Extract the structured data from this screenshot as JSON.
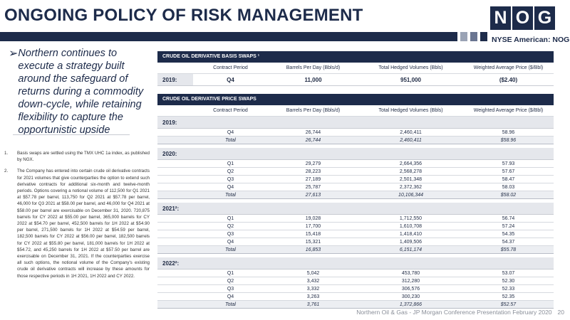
{
  "header": {
    "title": "ONGOING POLICY OF RISK MANAGEMENT",
    "logo_letters": [
      "N",
      "O",
      "G"
    ],
    "ticker": "NYSE American: NOG",
    "accent_squares": [
      "#9aa3b5",
      "#6a7591",
      "#1d2b4a"
    ]
  },
  "left": {
    "bullet_icon": "arrow-bullet",
    "bullet": "Northern continues to execute a strategy built around the safeguard of returns during a commodity down-cycle, while retaining flexibility to capture the opportunistic upside",
    "footnotes": [
      {
        "num": "1.",
        "text": "Basis swaps are settled using the TMX UHC 1a index, as published by NGX."
      },
      {
        "num": "2.",
        "text": "The Company has entered into certain crude oil derivative contracts for 2021 volumes that give counterparties the option to extend such derivative contracts for additional six-month and twelve-month periods. Options covering a notional volume of 112,500 for Q1 2021 at $57.78 per barrel, 113,750 for Q2 2021 at $57.78 per barrel, 46,000 for Q3 2021 at $58.00 per barrel, and 46,000 for Q4 2021 at $58.00 per barrel are exercisable on December 31, 2020. 720,875 barrels for CY 2022 at $55.00 per barrel, 365,000 barrels for CY 2022 at $54.70 per barrel, 452,500 barrels for 1H 2022 at $54.90 per barrel, 271,500 barrels for 1H 2022 at $54.59 per barrel, 182,500 barrels for CY 2022 at $56.00 per barrel, 182,500 barrels for CY 2022 at $55.80 per barrel, 181,000 barrels for 1H 2022 at $54.72, and 45,250 barrels for 1H 2022 at $57.50 per barrel are exercisable on December 31, 2021. If the counterparties exercise all such options, the notional volume of the Company's existing crude oil derivative contracts will increase by these amounts for those respective periods in 1H 2021, 1H 2022 and CY 2022."
      }
    ]
  },
  "basis_table": {
    "title": "CRUDE OIL DERIVATIVE BASIS SWAPS ¹",
    "columns": [
      "",
      "Contract Period",
      "Barrels Per Day (Bbls/d)",
      "Total Hedged Volumes (Bbls)",
      "Weighted Average Price ($/Bbl)"
    ],
    "rows": [
      {
        "year": "2019:",
        "period": "Q4",
        "bpd": "11,000",
        "volume": "951,000",
        "price": "($2.40)"
      }
    ]
  },
  "price_table": {
    "title": "CRUDE OIL DERIVATIVE PRICE SWAPS",
    "columns": [
      "",
      "Contract Period",
      "Barrels Per Day (Bbls/d)",
      "Total Hedged Volumes (Bbls)",
      "Weighted Average Price ($/Bbl)"
    ],
    "groups": [
      {
        "year": "2019:",
        "rows": [
          {
            "period": "Q4",
            "bpd": "26,744",
            "volume": "2,460,411",
            "price": "58.96"
          }
        ],
        "total": {
          "label": "Total",
          "bpd": "26,744",
          "volume": "2,460,411",
          "price": "$58.96"
        }
      },
      {
        "year": "2020:",
        "rows": [
          {
            "period": "Q1",
            "bpd": "29,279",
            "volume": "2,664,356",
            "price": "57.93"
          },
          {
            "period": "Q2",
            "bpd": "28,223",
            "volume": "2,568,278",
            "price": "57.67"
          },
          {
            "period": "Q3",
            "bpd": "27,189",
            "volume": "2,501,348",
            "price": "58.47"
          },
          {
            "period": "Q4",
            "bpd": "25,787",
            "volume": "2,372,362",
            "price": "58.03"
          }
        ],
        "total": {
          "label": "Total",
          "bpd": "27,613",
          "volume": "10,106,344",
          "price": "$58.02"
        }
      },
      {
        "year": "2021²:",
        "rows": [
          {
            "period": "Q1",
            "bpd": "19,028",
            "volume": "1,712,550",
            "price": "56.74"
          },
          {
            "period": "Q2",
            "bpd": "17,700",
            "volume": "1,610,708",
            "price": "57.24"
          },
          {
            "period": "Q3",
            "bpd": "15,418",
            "volume": "1,418,410",
            "price": "54.35"
          },
          {
            "period": "Q4",
            "bpd": "15,321",
            "volume": "1,409,506",
            "price": "54.37"
          }
        ],
        "total": {
          "label": "Total",
          "bpd": "16,853",
          "volume": "6,151,174",
          "price": "$55.78"
        }
      },
      {
        "year": "2022²:",
        "rows": [
          {
            "period": "Q1",
            "bpd": "5,042",
            "volume": "453,780",
            "price": "53.07"
          },
          {
            "period": "Q2",
            "bpd": "3,432",
            "volume": "312,280",
            "price": "52.30"
          },
          {
            "period": "Q3",
            "bpd": "3,332",
            "volume": "306,576",
            "price": "52.33"
          },
          {
            "period": "Q4",
            "bpd": "3,263",
            "volume": "300,230",
            "price": "52.35"
          }
        ],
        "total": {
          "label": "Total",
          "bpd": "3,761",
          "volume": "1,372,866",
          "price": "$52.57"
        }
      }
    ]
  },
  "footer": {
    "text": "Northern Oil & Gas - JP Morgan Conference Presentation February 2020",
    "page": "20"
  }
}
